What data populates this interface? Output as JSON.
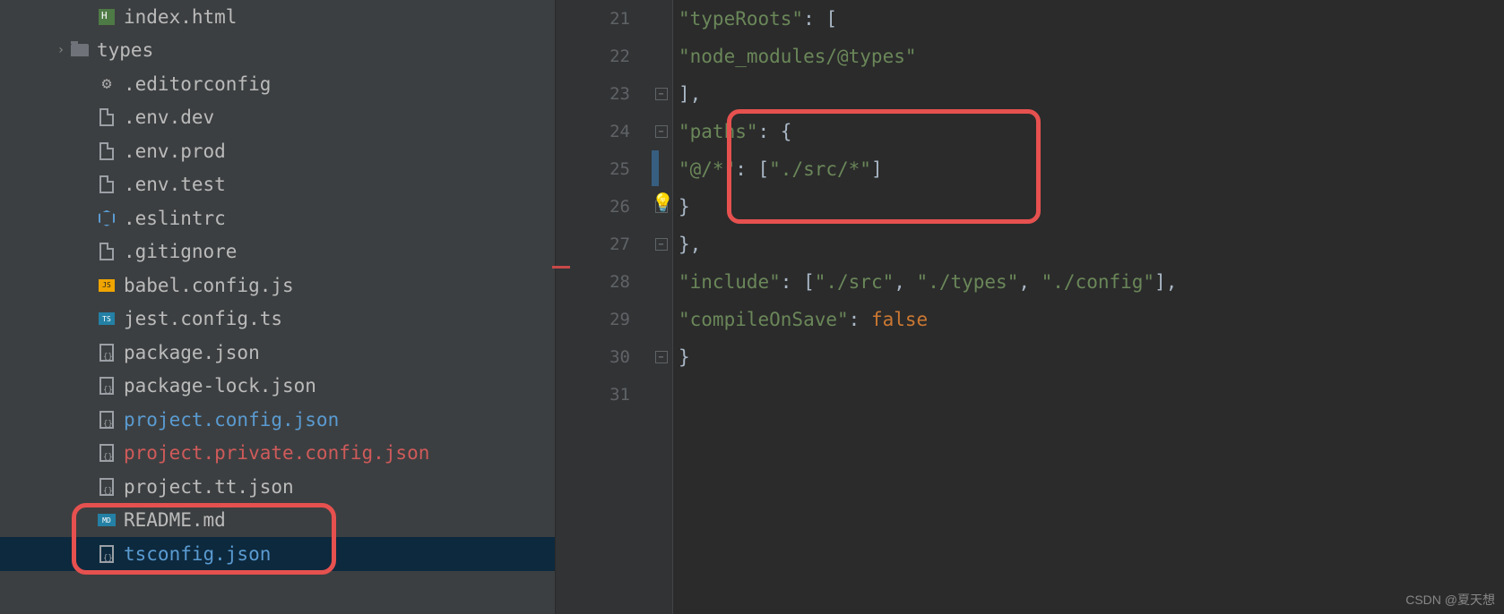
{
  "sidebar": {
    "items": [
      {
        "label": "index.html",
        "indent": "indent-2",
        "icon": "ico-html",
        "color": ""
      },
      {
        "label": "types",
        "indent": "indent-1",
        "icon": "ico-folder",
        "color": "",
        "chev": "›"
      },
      {
        "label": ".editorconfig",
        "indent": "indent-2",
        "icon": "ico-gear",
        "color": ""
      },
      {
        "label": ".env.dev",
        "indent": "indent-2",
        "icon": "ico-file",
        "color": ""
      },
      {
        "label": ".env.prod",
        "indent": "indent-2",
        "icon": "ico-file",
        "color": ""
      },
      {
        "label": ".env.test",
        "indent": "indent-2",
        "icon": "ico-file",
        "color": ""
      },
      {
        "label": ".eslintrc",
        "indent": "indent-2",
        "icon": "ico-hex",
        "color": ""
      },
      {
        "label": ".gitignore",
        "indent": "indent-2",
        "icon": "ico-file",
        "color": ""
      },
      {
        "label": "babel.config.js",
        "indent": "indent-2",
        "icon": "ico-js",
        "iconText": "JS",
        "color": ""
      },
      {
        "label": "jest.config.ts",
        "indent": "indent-2",
        "icon": "ico-ts",
        "iconText": "TS",
        "color": ""
      },
      {
        "label": "package.json",
        "indent": "indent-2",
        "icon": "ico-json",
        "color": ""
      },
      {
        "label": "package-lock.json",
        "indent": "indent-2",
        "icon": "ico-json",
        "color": ""
      },
      {
        "label": "project.config.json",
        "indent": "indent-2",
        "icon": "ico-json",
        "color": "blue"
      },
      {
        "label": "project.private.config.json",
        "indent": "indent-2",
        "icon": "ico-json",
        "color": "red"
      },
      {
        "label": "project.tt.json",
        "indent": "indent-2",
        "icon": "ico-json",
        "color": ""
      },
      {
        "label": "README.md",
        "indent": "indent-2",
        "icon": "ico-md",
        "iconText": "MD",
        "color": ""
      },
      {
        "label": "tsconfig.json",
        "indent": "indent-2",
        "icon": "ico-json",
        "color": "blue",
        "selected": true
      }
    ]
  },
  "gutter": [
    "21",
    "22",
    "23",
    "24",
    "25",
    "26",
    "27",
    "28",
    "29",
    "30",
    "31"
  ],
  "code": {
    "l21": {
      "s1": "\"typeRoots\"",
      "p1": ": ["
    },
    "l22": {
      "s1": "\"node_modules/@types\""
    },
    "l23": {
      "p1": "],"
    },
    "l24": {
      "s1": "\"paths\"",
      "p1": ": {"
    },
    "l25": {
      "s1": "\"@/*\"",
      "p1": ": [",
      "s2": "\"./src/*\"",
      "p2": "]"
    },
    "l26": {
      "p1": "}"
    },
    "l27": {
      "p1": "},"
    },
    "l28": {
      "s1": "\"include\"",
      "p1": ": [",
      "s2": "\"./src\"",
      "p2": ", ",
      "s3": "\"./types\"",
      "p3": ", ",
      "s4": "\"./config\"",
      "p4": "],"
    },
    "l29": {
      "s1": "\"compileOnSave\"",
      "p1": ": ",
      "k1": "false"
    },
    "l30": {
      "p1": "}"
    }
  },
  "watermark": "CSDN @夏天想"
}
